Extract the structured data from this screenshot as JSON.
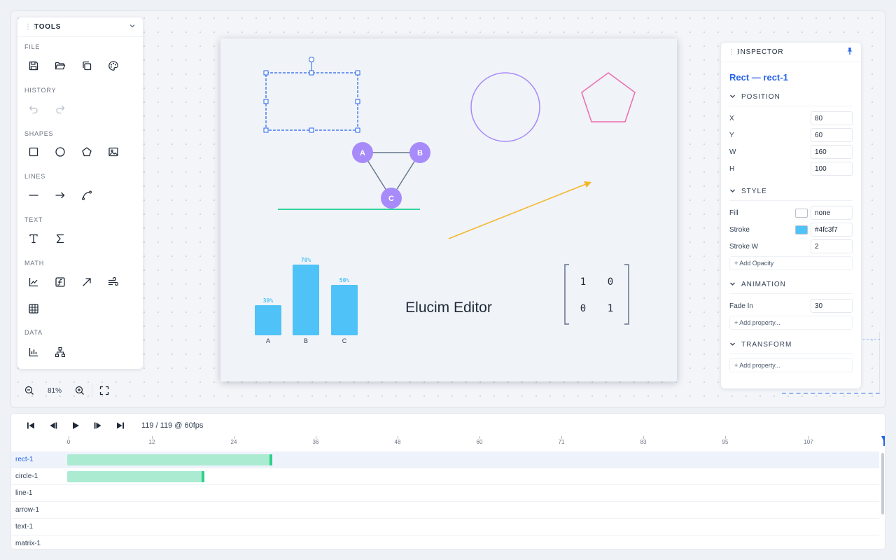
{
  "tools": {
    "title": "TOOLS",
    "groups": {
      "file": "FILE",
      "history": "HISTORY",
      "shapes": "SHAPES",
      "lines": "LINES",
      "text": "TEXT",
      "math": "MATH",
      "data": "DATA"
    }
  },
  "zoom": {
    "level": "81%"
  },
  "canvas": {
    "graph_nodes": [
      "A",
      "B",
      "C"
    ],
    "bar_chart": {
      "categories": [
        "A",
        "B",
        "C"
      ],
      "value_labels": [
        "30%",
        "70%",
        "50%"
      ]
    },
    "title_text": "Elucim Editor",
    "matrix": [
      "1",
      "0",
      "0",
      "1"
    ],
    "colors": {
      "selection": "#2563eb",
      "circle_stroke": "#a78bfa",
      "pentagon_stroke": "#ec6bad",
      "node_fill": "#a78bfa",
      "green_line": "#34d399",
      "arrow": "#f5b62a",
      "bars": "#4fc3f7"
    }
  },
  "inspector": {
    "title": "INSPECTOR",
    "selected": "Rect — rect-1",
    "sections": {
      "position": "POSITION",
      "style": "STYLE",
      "animation": "ANIMATION",
      "transform": "TRANSFORM"
    },
    "position": {
      "x_label": "X",
      "x": "80",
      "y_label": "Y",
      "y": "60",
      "w_label": "W",
      "w": "160",
      "h_label": "H",
      "h": "100"
    },
    "style": {
      "fill_label": "Fill",
      "fill": "none",
      "stroke_label": "Stroke",
      "stroke": "#4fc3f7",
      "stroke_w_label": "Stroke W",
      "stroke_w": "2",
      "add_opacity": "+ Add Opacity"
    },
    "animation": {
      "fade_in_label": "Fade In",
      "fade_in": "30",
      "add_property": "+ Add property..."
    },
    "transform": {
      "add_property": "+ Add property..."
    }
  },
  "timeline": {
    "frame_readout": "119 / 119 @ 60fps",
    "ticks": [
      "0",
      "12",
      "24",
      "36",
      "48",
      "60",
      "71",
      "83",
      "95",
      "107"
    ],
    "tracks": [
      {
        "label": "rect-1"
      },
      {
        "label": "circle-1"
      },
      {
        "label": "line-1"
      },
      {
        "label": "arrow-1"
      },
      {
        "label": "text-1"
      },
      {
        "label": "matrix-1"
      }
    ]
  }
}
